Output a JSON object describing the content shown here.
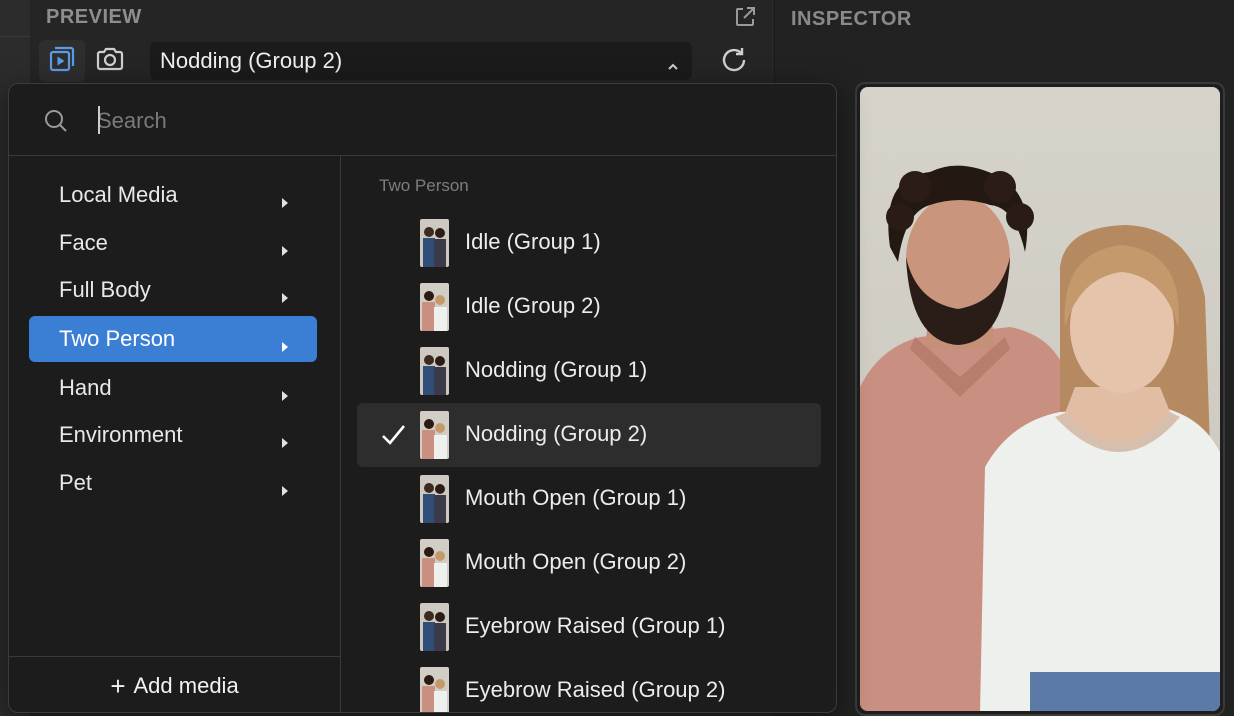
{
  "preview": {
    "title": "PREVIEW",
    "selected_media": "Nodding (Group 2)"
  },
  "inspector": {
    "title": "INSPECTOR"
  },
  "media_menu": {
    "search_placeholder": "Search",
    "categories": [
      {
        "label": "Local Media",
        "selected": false
      },
      {
        "label": "Face",
        "selected": false
      },
      {
        "label": "Full Body",
        "selected": false
      },
      {
        "label": "Two Person",
        "selected": true
      },
      {
        "label": "Hand",
        "selected": false
      },
      {
        "label": "Environment",
        "selected": false
      },
      {
        "label": "Pet",
        "selected": false
      }
    ],
    "add_media_label": "Add media",
    "submenu_header": "Two Person",
    "items": [
      {
        "label": "Idle (Group 1)",
        "selected": false,
        "group": 1
      },
      {
        "label": "Idle (Group 2)",
        "selected": false,
        "group": 2
      },
      {
        "label": "Nodding (Group 1)",
        "selected": false,
        "group": 1
      },
      {
        "label": "Nodding (Group 2)",
        "selected": true,
        "group": 2
      },
      {
        "label": "Mouth Open (Group 1)",
        "selected": false,
        "group": 1
      },
      {
        "label": "Mouth Open (Group 2)",
        "selected": false,
        "group": 2
      },
      {
        "label": "Eyebrow Raised (Group 1)",
        "selected": false,
        "group": 1
      },
      {
        "label": "Eyebrow Raised (Group 2)",
        "selected": false,
        "group": 2
      }
    ]
  },
  "colors": {
    "accent": "#3b7fd4",
    "panel_bg": "#252525",
    "menu_bg": "#1c1c1c",
    "icon_active": "#5b9be8"
  },
  "icons": {
    "preview_mode": "play-in-stack-icon",
    "camera": "camera-icon",
    "chevron": "chevron-up-icon",
    "refresh": "refresh-icon",
    "external": "external-link-icon",
    "search": "search-icon",
    "check": "checkmark-icon",
    "arrow": "triangle-right-icon"
  }
}
